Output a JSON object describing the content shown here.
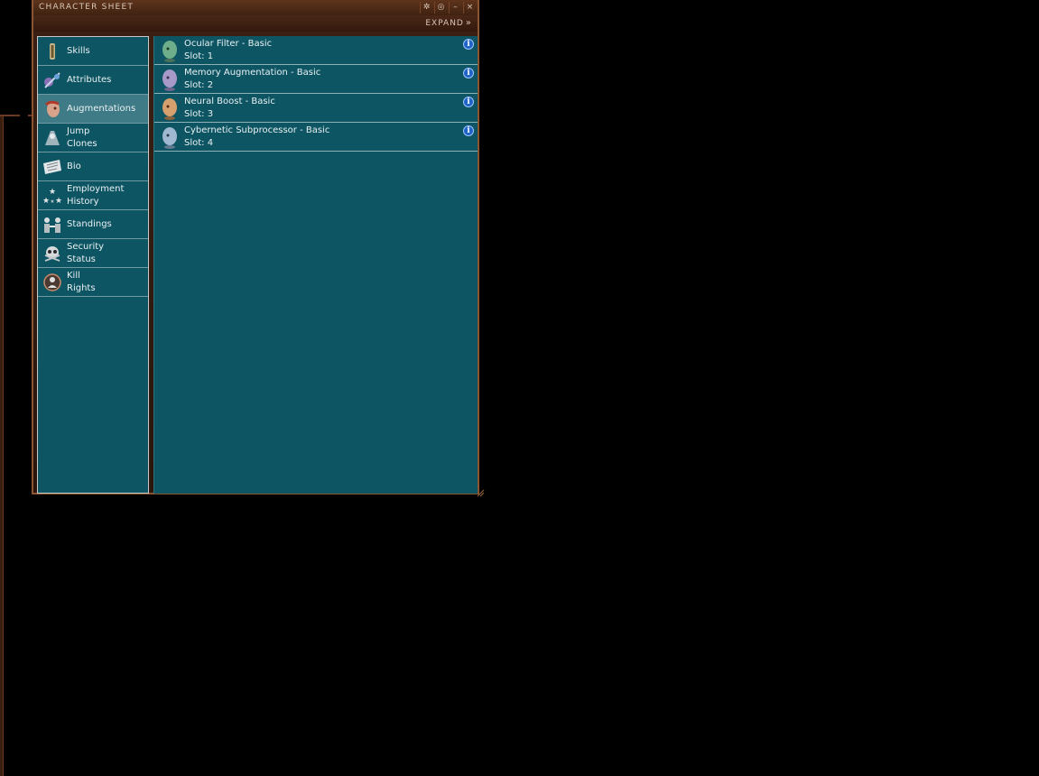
{
  "window": {
    "title": "CHARACTER SHEET",
    "expand_label": "EXPAND",
    "controls": [
      "settings-icon",
      "target-icon",
      "minimize-icon",
      "close-icon"
    ]
  },
  "sidebar": {
    "items": [
      {
        "label": "Skills",
        "icon": "skills-icon",
        "selected": false
      },
      {
        "label": "Attributes",
        "icon": "attributes-icon",
        "selected": false
      },
      {
        "label": "Augmentations",
        "icon": "augmentations-icon",
        "selected": true
      },
      {
        "label": "Jump\nClones",
        "icon": "jump-clones-icon",
        "selected": false
      },
      {
        "label": "Bio",
        "icon": "bio-icon",
        "selected": false
      },
      {
        "label": "Employment\nHistory",
        "icon": "employment-history-icon",
        "selected": false
      },
      {
        "label": "Standings",
        "icon": "standings-icon",
        "selected": false
      },
      {
        "label": "Security\nStatus",
        "icon": "security-status-icon",
        "selected": false
      },
      {
        "label": "Kill\nRights",
        "icon": "kill-rights-icon",
        "selected": false
      }
    ]
  },
  "implants": [
    {
      "name": "Ocular Filter - Basic",
      "slot": "Slot: 1",
      "icon": "implant-head-green-icon",
      "color": "#6fae8a"
    },
    {
      "name": "Memory Augmentation - Basic",
      "slot": "Slot: 2",
      "icon": "implant-head-purple-icon",
      "color": "#a79ac8"
    },
    {
      "name": "Neural Boost - Basic",
      "slot": "Slot: 3",
      "icon": "implant-head-orange-icon",
      "color": "#d6a06e"
    },
    {
      "name": "Cybernetic Subprocessor - Basic",
      "slot": "Slot: 4",
      "icon": "implant-head-blue-icon",
      "color": "#9fb9d2"
    }
  ],
  "colors": {
    "panel": "#0d5563",
    "selected": "#3f7b86",
    "frame": "#8c5532",
    "info": "#1f63c7"
  }
}
